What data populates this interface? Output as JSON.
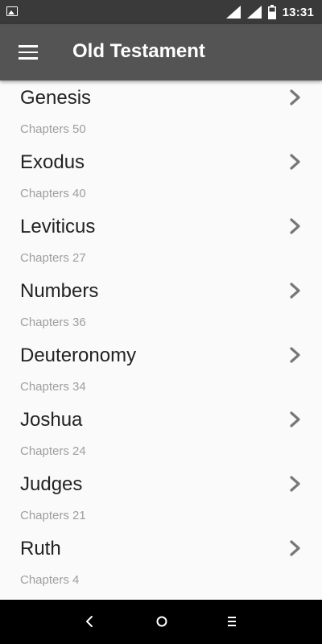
{
  "status_bar": {
    "time": "13:31",
    "icons": [
      "image-icon",
      "signal-icon",
      "signal-icon",
      "battery-icon"
    ]
  },
  "app_bar": {
    "title": "Old Testament",
    "menu_icon": "menu-icon"
  },
  "books": [
    {
      "name": "Genesis",
      "chapters": "Chapters 50"
    },
    {
      "name": "Exodus",
      "chapters": "Chapters 40"
    },
    {
      "name": "Leviticus",
      "chapters": "Chapters 27"
    },
    {
      "name": "Numbers",
      "chapters": "Chapters 36"
    },
    {
      "name": "Deuteronomy",
      "chapters": "Chapters 34"
    },
    {
      "name": "Joshua",
      "chapters": "Chapters 24"
    },
    {
      "name": "Judges",
      "chapters": "Chapters 21"
    },
    {
      "name": "Ruth",
      "chapters": "Chapters 4"
    }
  ],
  "nav_bar": {
    "icons": [
      "back-icon",
      "home-icon",
      "recent-apps-icon"
    ]
  },
  "colors": {
    "status_bar": "#3a3a3a",
    "app_bar": "#545454",
    "background": "#fafafa",
    "book_name": "#222222",
    "chapters_text": "#9e9e9e",
    "chevron": "#777777",
    "nav_bar": "#000000"
  }
}
